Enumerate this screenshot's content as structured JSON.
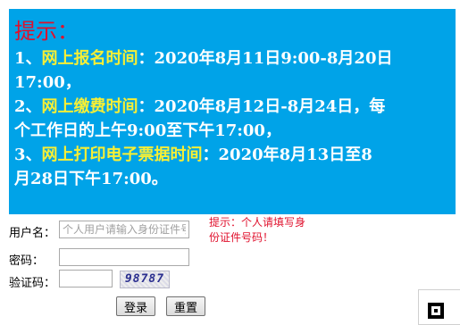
{
  "notice": {
    "title": "提示：",
    "items": [
      {
        "num": "1、",
        "label": "网上报名时间",
        "sep": "：",
        "text_line1": "2020年8月11日9:00-8月20日",
        "text_line2": "17:00，"
      },
      {
        "num": "2、",
        "label": "网上缴费时间",
        "sep": "：",
        "text_line1": "2020年8月12日-8月24日，每",
        "text_line2": "个工作日的上午9:00至下午17:00，"
      },
      {
        "num": "3、",
        "label": "网上打印电子票据时间",
        "sep": "：",
        "text_line1": "2020年8月13日至8",
        "text_line2": "月28日下午17:00。"
      }
    ]
  },
  "form": {
    "username_label": "用户名：",
    "username_placeholder": "个人用户请输入身份证件号码",
    "password_label": "密码：",
    "captcha_label": "验证码：",
    "captcha_image_text": "98787",
    "hint_line1": "提示：个人请填写身",
    "hint_line2": "份证件号码！",
    "login_button": "登录",
    "reset_button": "重置"
  },
  "colors": {
    "notice_background": "#00a3e8",
    "highlight_text": "#f7ef35",
    "title_red": "#e0102c"
  }
}
